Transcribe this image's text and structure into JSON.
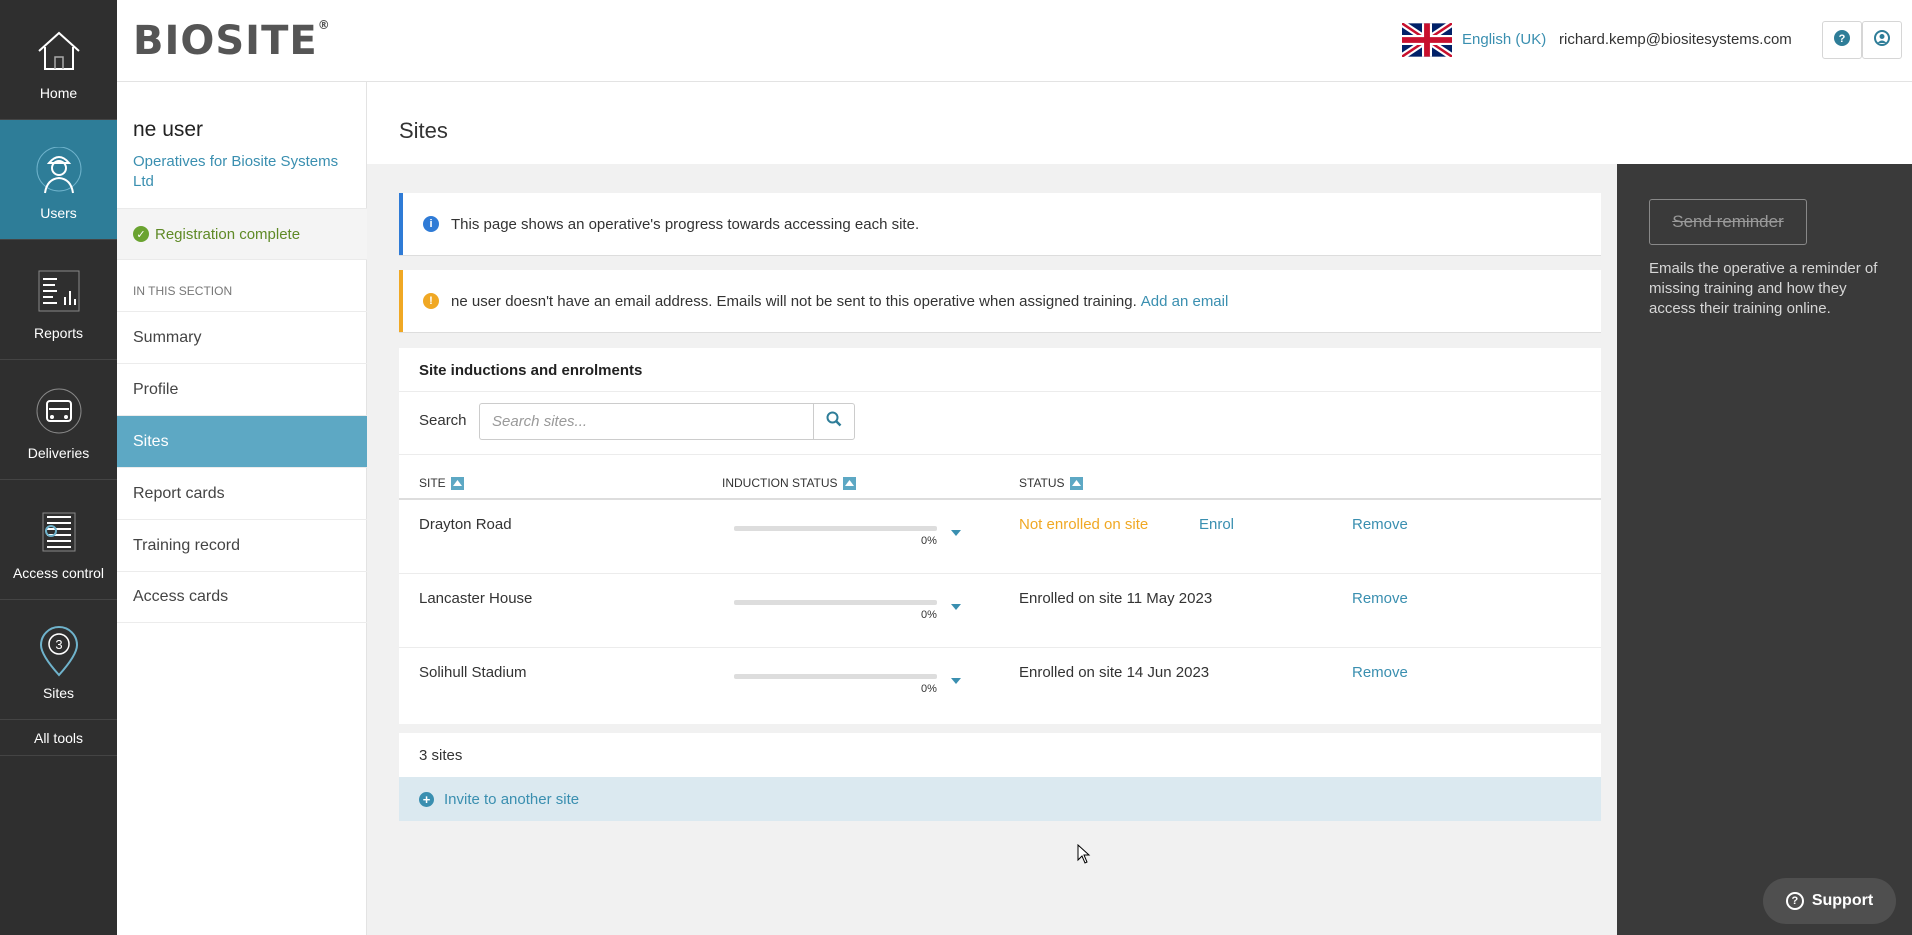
{
  "rail": {
    "items": [
      {
        "label": "Home",
        "icon": "home-icon"
      },
      {
        "label": "Users",
        "icon": "worker-icon"
      },
      {
        "label": "Reports",
        "icon": "report-icon"
      },
      {
        "label": "Deliveries",
        "icon": "truck-icon"
      },
      {
        "label": "Access control",
        "icon": "access-control-icon"
      },
      {
        "label": "Sites",
        "icon": "map-pin-icon",
        "badge": "3"
      }
    ],
    "all_tools": "All tools"
  },
  "header": {
    "logo": "BIOSITE",
    "logo_mark": "®",
    "language": "English (UK)",
    "user_email": "richard.kemp@biositesystems.com",
    "help_icon": "help-icon",
    "account_icon": "account-icon"
  },
  "subnav": {
    "user_name": "ne user",
    "organisation": "Operatives for Biosite Systems Ltd",
    "registration": "Registration complete",
    "section_label": "IN THIS SECTION",
    "items": [
      {
        "label": "Summary"
      },
      {
        "label": "Profile"
      },
      {
        "label": "Sites"
      },
      {
        "label": "Report cards"
      },
      {
        "label": "Training record"
      },
      {
        "label": "Access cards"
      }
    ]
  },
  "page": {
    "title": "Sites",
    "info_alert": "This page shows an operative's progress towards accessing each site.",
    "warn_alert": "ne user doesn't have an email address. Emails will not be sent to this operative when assigned training.",
    "warn_link": "Add an email"
  },
  "table": {
    "title": "Site inductions and enrolments",
    "search_label": "Search",
    "search_placeholder": "Search sites...",
    "columns": [
      "SITE",
      "INDUCTION STATUS",
      "STATUS"
    ],
    "rows": [
      {
        "site": "Drayton Road",
        "progress": 0,
        "progress_label": "0%",
        "status": "Not enrolled on site",
        "status_type": "warning",
        "enrol": "Enrol",
        "remove": "Remove"
      },
      {
        "site": "Lancaster House",
        "progress": 0,
        "progress_label": "0%",
        "status": "Enrolled on site 11 May 2023",
        "status_type": "normal",
        "enrol": "",
        "remove": "Remove"
      },
      {
        "site": "Solihull Stadium",
        "progress": 0,
        "progress_label": "0%",
        "status": "Enrolled on site 14 Jun 2023",
        "status_type": "normal",
        "enrol": "",
        "remove": "Remove"
      }
    ],
    "count": "3 sites",
    "invite": "Invite to another site"
  },
  "right_panel": {
    "button": "Send reminder",
    "description": "Emails the operative a reminder of missing training and how they access their training online."
  },
  "support": "Support",
  "colors": {
    "accent": "#2e7d98",
    "link": "#3a8fb0",
    "active_nav": "#5da8c4",
    "warning": "#f0a824",
    "info": "#2f7bd6",
    "success": "#6aa330"
  }
}
